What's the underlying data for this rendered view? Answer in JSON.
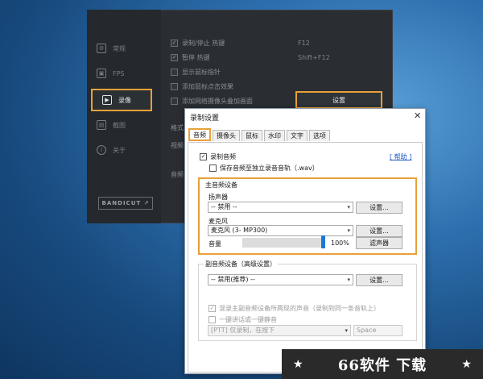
{
  "back_window": {
    "sidebar": [
      {
        "label": "常规",
        "icon": "gear-icon"
      },
      {
        "label": "FPS",
        "icon": "fps-icon"
      },
      {
        "label": "录像",
        "icon": "video-icon"
      },
      {
        "label": "截图",
        "icon": "image-icon"
      },
      {
        "label": "关于",
        "icon": "info-icon"
      }
    ],
    "options": [
      {
        "label": "录制/停止 热键",
        "hotkey": "F12"
      },
      {
        "label": "暂停 热键",
        "hotkey": "Shift+F12"
      },
      {
        "label": "显示鼠标指针",
        "hotkey": ""
      },
      {
        "label": "添加鼠标点击效果",
        "hotkey": ""
      },
      {
        "label": "添加网络摄像头叠加画面",
        "hotkey": ""
      }
    ],
    "format_label": "格式",
    "video_label": "视频",
    "audio_label": "音频",
    "settings_button": "设置",
    "bandicut_label": "BANDICUT ↗"
  },
  "dialog": {
    "title": "录制设置",
    "close": "✕",
    "tabs": [
      "音频",
      "摄像头",
      "鼠标",
      "水印",
      "文字",
      "选项"
    ],
    "record_audio": "录制音频",
    "save_separate": "保存音频至独立录音音轨（.wav）",
    "help": "[ 帮助 ]",
    "main_group_title": "主音频设备",
    "speaker_label": "扬声器",
    "speaker_value": "-- 禁用 --",
    "mic_label": "麦克风",
    "mic_value": "麦克风 (3- MP300)",
    "volume_label": "音量",
    "volume_value": "100%",
    "volume_fraction": 1.0,
    "settings_btn": "设置...",
    "filter_btn": "滤声器",
    "secondary_group_title": "副音频设备（高级设置）",
    "secondary_value": "-- 禁用(推荐) --",
    "mix_option": "混录主副音频设备所两现的声音（录制到同一条音轨上）",
    "ptt_option": "一键讲话或一键静音",
    "ptt_value": "[PTT] 仅录制，在按下",
    "ptt_key": "Space"
  },
  "watermark": {
    "star_left": "★",
    "text": "66软件 下载",
    "star_right": "★"
  }
}
